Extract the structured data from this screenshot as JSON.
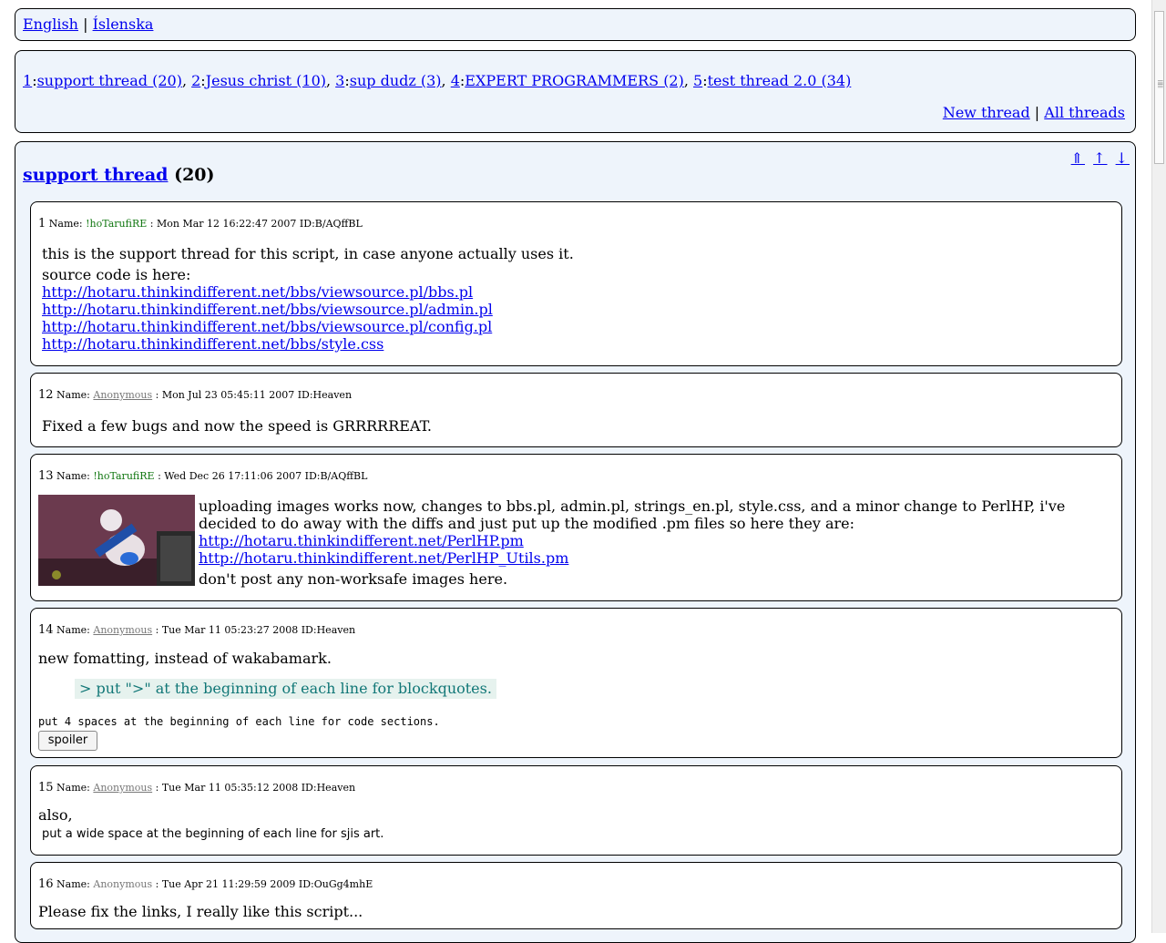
{
  "lang": {
    "english": "English",
    "sep": "|",
    "icelandic": "Íslenska"
  },
  "menu": {
    "threads": [
      {
        "num": "1",
        "title": "support thread (20)"
      },
      {
        "num": "2",
        "title": "Jesus christ (10)"
      },
      {
        "num": "3",
        "title": "sup dudz (3)"
      },
      {
        "num": "4",
        "title": "EXPERT PROGRAMMERS (2)"
      },
      {
        "num": "5",
        "title": "test thread 2.0 (34)"
      }
    ],
    "new_thread": "New thread",
    "sep": "|",
    "all_threads": "All threads"
  },
  "thread": {
    "nav": {
      "first": "⇑",
      "up": "↑",
      "down": "↓"
    },
    "title": "support thread",
    "count": "(20)",
    "posts": [
      {
        "num": "1",
        "name_label": "Name:",
        "name": "!hoTarufiRE",
        "date": ": Mon Mar 12 16:22:47 2007 ID:B/AQffBL",
        "line1": "this is the support thread for this script, in case anyone actually uses it.",
        "line2": "source code is here:",
        "links": [
          "http://hotaru.thinkindifferent.net/bbs/viewsource.pl/bbs.pl",
          "http://hotaru.thinkindifferent.net/bbs/viewsource.pl/admin.pl",
          "http://hotaru.thinkindifferent.net/bbs/viewsource.pl/config.pl",
          "http://hotaru.thinkindifferent.net/bbs/style.css"
        ]
      },
      {
        "num": "12",
        "name_label": "Name:",
        "name": "Anonymous",
        "date": ": Mon Jul 23 05:45:11 2007 ID:Heaven",
        "text": "Fixed a few bugs and now the speed is GRRRRREAT."
      },
      {
        "num": "13",
        "name_label": "Name:",
        "name": "!hoTarufiRE",
        "date": ": Wed Dec 26 17:11:06 2007 ID:B/AQffBL",
        "text": "uploading images works now, changes to bbs.pl, admin.pl, strings_en.pl, style.css, and a minor change to PerlHP, i've decided to do away with the diffs and just put up the modified .pm files so here they are:",
        "links": [
          "http://hotaru.thinkindifferent.net/PerlHP.pm",
          "http://hotaru.thinkindifferent.net/PerlHP_Utils.pm"
        ],
        "after": "don't post any non-worksafe images here."
      },
      {
        "num": "14",
        "name_label": "Name:",
        "name": "Anonymous",
        "date": ": Tue Mar 11 05:23:27 2008 ID:Heaven",
        "text": "new fomatting, instead of wakabamark.",
        "quote": "> put \">\" at the beginning of each line for blockquotes.",
        "code": "put 4 spaces at the beginning of each line for code sections.",
        "spoiler": "spoiler"
      },
      {
        "num": "15",
        "name_label": "Name:",
        "name": "Anonymous",
        "date": ": Tue Mar 11 05:35:12 2008 ID:Heaven",
        "text": "also,",
        "sjis": "put a wide space at the beginning of each line for sjis art."
      },
      {
        "num": "16",
        "name_label": "Name:",
        "name": "Anonymous",
        "date": ": Tue Apr 21 11:29:59 2009 ID:OuGg4mhE",
        "text": "Please fix the links, I really like this script..."
      }
    ]
  },
  "colors": {
    "box_bg": "#eef4fb",
    "tripcode": "#117711",
    "quote": "#117777",
    "link": "#0000ee"
  }
}
